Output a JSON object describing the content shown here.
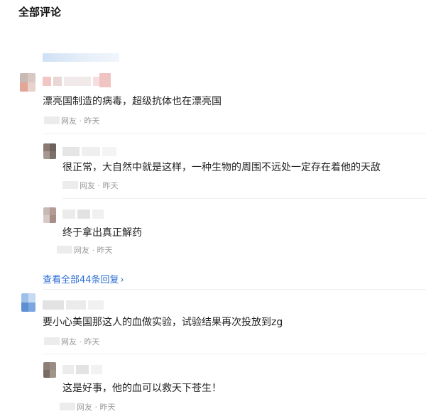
{
  "header": {
    "title": "全部评论"
  },
  "comments": [
    {
      "text": "漂亮国制造的病毒，超级抗体也在漂亮国",
      "source": "网友",
      "separator": "·",
      "time": "昨天"
    },
    {
      "text": "要小心美国那这人的血做实验，试验结果再次投放到zg",
      "source": "网友",
      "separator": "·",
      "time": "昨天"
    }
  ],
  "replies": [
    {
      "text": "很正常，大自然中就是这样，一种生物的周围不远处一定存在着他的天敌",
      "source": "网友",
      "separator": "·",
      "time": "昨天"
    },
    {
      "text": "终于拿出真正解药",
      "source": "网友",
      "separator": "·",
      "time": "昨天"
    },
    {
      "text": "这是好事，他的血可以救天下苍生！",
      "source": "网友",
      "separator": "·",
      "time": "昨天"
    }
  ],
  "view_all_replies": {
    "label": "查看全部44条回复",
    "chevron": "›"
  },
  "accent_color": "#2b6bd6"
}
